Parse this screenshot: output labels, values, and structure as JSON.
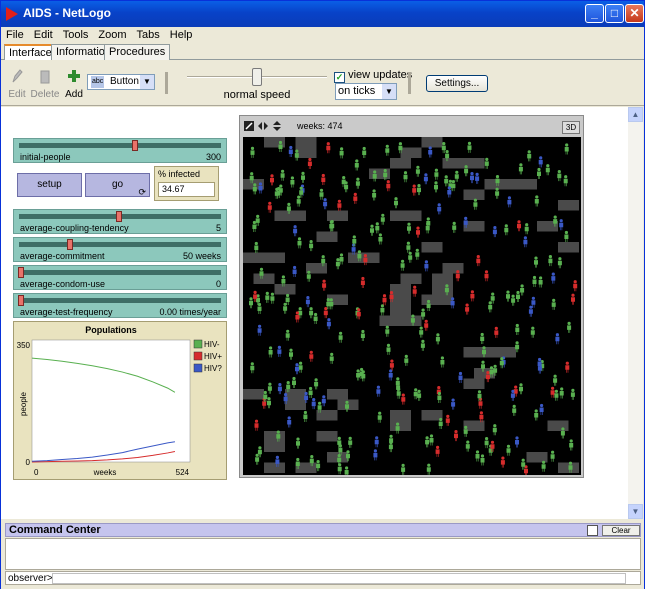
{
  "window": {
    "title": "AIDS - NetLogo"
  },
  "menu": [
    "File",
    "Edit",
    "Tools",
    "Zoom",
    "Tabs",
    "Help"
  ],
  "tabs": [
    "Interface",
    "Information",
    "Procedures"
  ],
  "toolbar": {
    "edit": "Edit",
    "delete": "Delete",
    "add": "Add",
    "widget_type_icon": "abc",
    "widget_type": "Button",
    "speed_label": "normal speed",
    "speed_level": 0.5,
    "view_updates_label": "view updates",
    "view_updates_checked": true,
    "update_mode": "on ticks",
    "settings": "Settings..."
  },
  "sliders": [
    {
      "name": "initial-people",
      "value": "300",
      "fraction": 0.58
    },
    {
      "name": "average-coupling-tendency",
      "value": "5",
      "fraction": 0.5
    },
    {
      "name": "average-commitment",
      "value": "50 weeks",
      "fraction": 0.25
    },
    {
      "name": "average-condom-use",
      "value": "0",
      "fraction": 0.0
    },
    {
      "name": "average-test-frequency",
      "value": "0.00 times/year",
      "fraction": 0.0
    }
  ],
  "buttons": {
    "setup": "setup",
    "go": "go"
  },
  "monitor": {
    "label": "% infected",
    "value": "34.67"
  },
  "view": {
    "ticks_label": "weeks: 474",
    "three_d": "3D"
  },
  "command_center": {
    "title": "Command Center",
    "clear": "Clear",
    "prompt": "observer>"
  },
  "colors": {
    "hiv_neg": "#59b050",
    "hiv_pos": "#d62c2c",
    "hiv_unknown": "#3a58c6"
  },
  "chart_data": {
    "type": "line",
    "title": "Populations",
    "xlabel": "weeks",
    "ylabel": "people",
    "xlim": [
      0,
      524
    ],
    "ylim": [
      0,
      350
    ],
    "x_ticks": [
      "0",
      "524"
    ],
    "y_ticks": [
      "0",
      "350"
    ],
    "legend_position": "top-right",
    "series": [
      {
        "name": "HIV-",
        "color": "#59b050",
        "x": [
          0,
          50,
          100,
          150,
          200,
          250,
          300,
          350,
          400,
          450,
          474
        ],
        "y": [
          298,
          294,
          289,
          283,
          276,
          268,
          258,
          246,
          230,
          212,
          200
        ]
      },
      {
        "name": "HIV+",
        "color": "#d62c2c",
        "x": [
          0,
          50,
          100,
          150,
          200,
          250,
          300,
          350,
          400,
          450,
          474
        ],
        "y": [
          0,
          1,
          2,
          3,
          4,
          6,
          9,
          13,
          19,
          26,
          30
        ]
      },
      {
        "name": "HIV?",
        "color": "#3a58c6",
        "x": [
          0,
          50,
          100,
          150,
          200,
          250,
          300,
          350,
          400,
          450,
          474
        ],
        "y": [
          2,
          4,
          7,
          10,
          14,
          20,
          27,
          37,
          46,
          55,
          58
        ]
      }
    ]
  }
}
